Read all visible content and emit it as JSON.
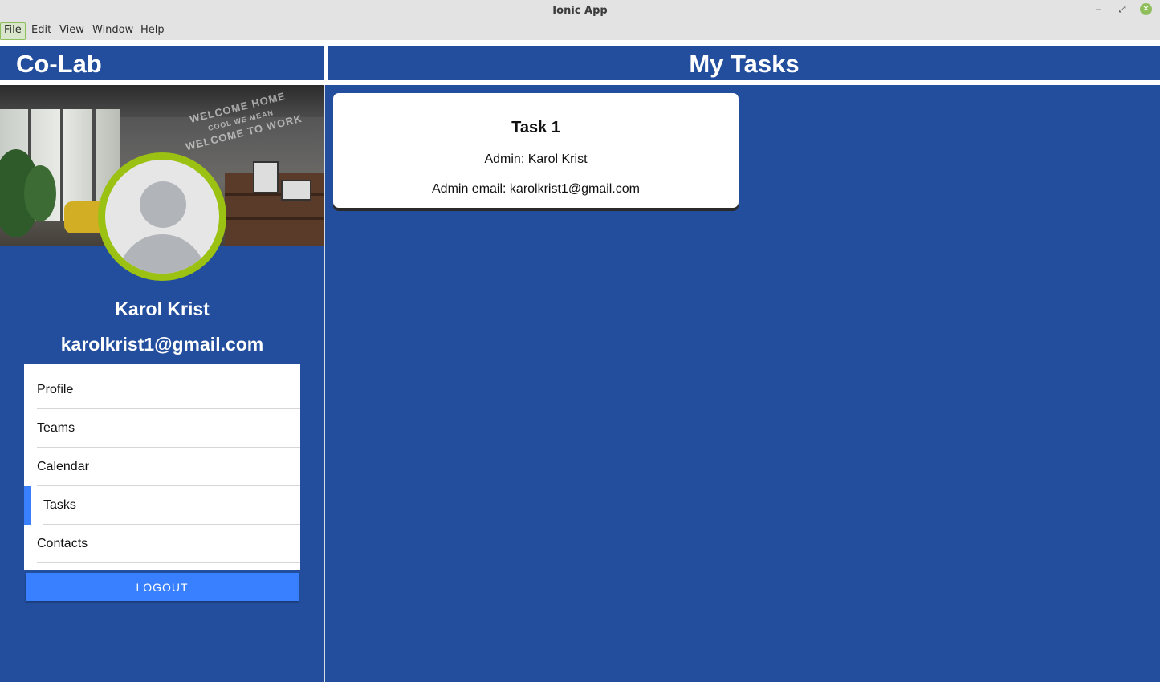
{
  "window": {
    "title": "Ionic App",
    "controls": {
      "minimize": "‒",
      "maximize": "⤢",
      "close": "✕"
    }
  },
  "menubar": {
    "items": [
      "File",
      "Edit",
      "View",
      "Window",
      "Help"
    ]
  },
  "header": {
    "app_title": "Co-Lab",
    "page_title": "My Tasks"
  },
  "sidebar": {
    "cover_neon": [
      "WELCOME HOME",
      "COOL WE MEAN",
      "WELCOME TO WORK"
    ],
    "user": {
      "name": "Karol Krist",
      "email": "karolkrist1@gmail.com"
    },
    "nav": [
      {
        "label": "Profile"
      },
      {
        "label": "Teams"
      },
      {
        "label": "Calendar"
      },
      {
        "label": "Tasks",
        "active": true
      },
      {
        "label": "Contacts"
      }
    ],
    "logout_label": "LOGOUT"
  },
  "tasks": [
    {
      "title": "Task 1",
      "admin_line": "Admin: Karol Krist",
      "email_line": "Admin email: karolkrist1@gmail.com"
    }
  ],
  "colors": {
    "primary": "#234e9e",
    "accent": "#3880ff",
    "avatar_ring": "#9bc113"
  }
}
